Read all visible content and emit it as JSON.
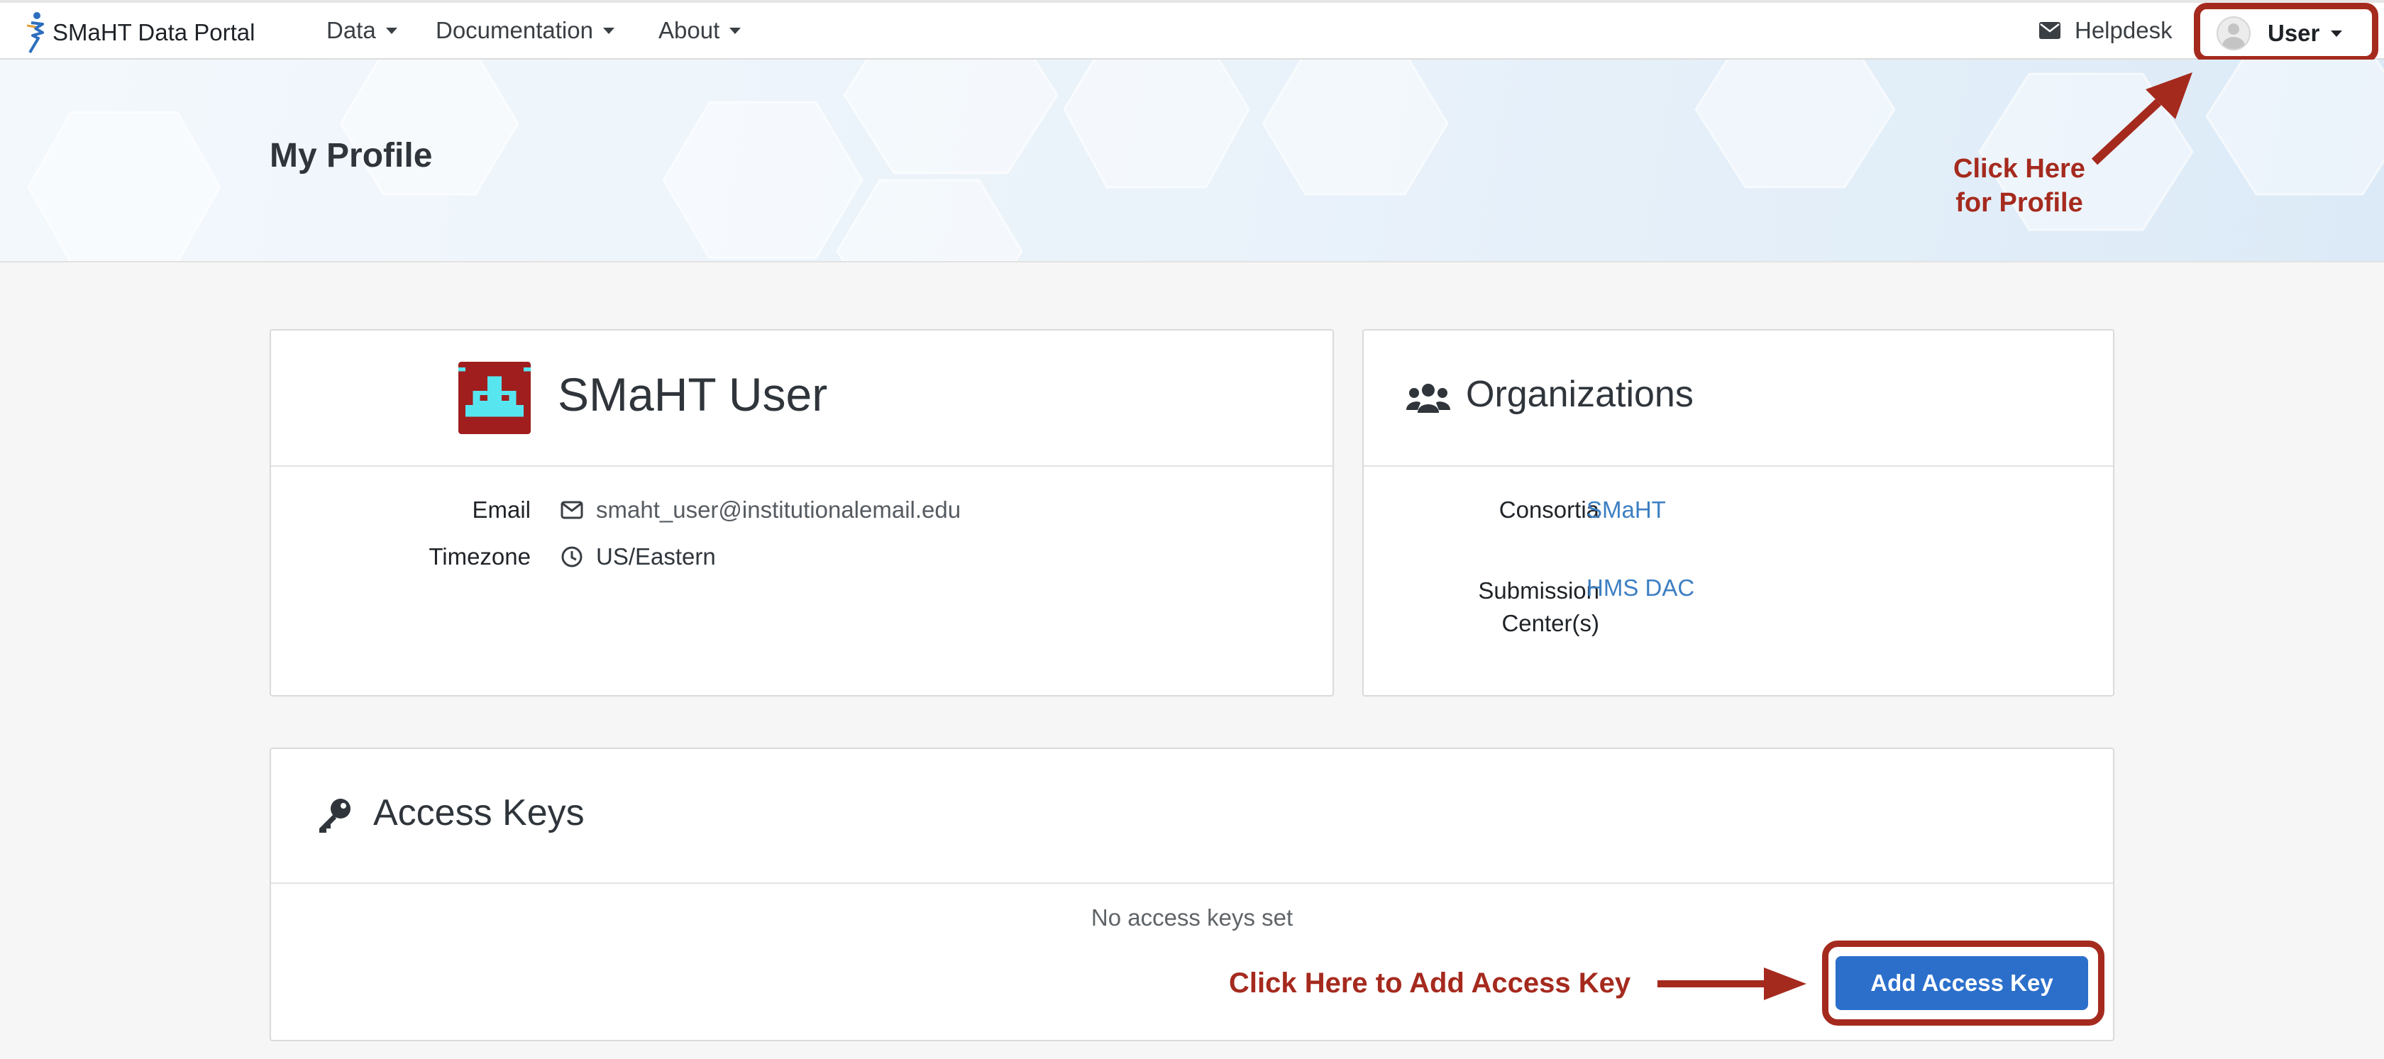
{
  "navbar": {
    "brand": "SMaHT Data Portal",
    "menus": [
      {
        "label": "Data"
      },
      {
        "label": "Documentation"
      },
      {
        "label": "About"
      }
    ],
    "helpdesk": "Helpdesk",
    "user_label": "User"
  },
  "hero": {
    "title": "My Profile",
    "annotation_profile_line1": "Click Here",
    "annotation_profile_line2": "for Profile"
  },
  "profile": {
    "name": "SMaHT User",
    "email_label": "Email",
    "email": "smaht_user@institutionalemail.edu",
    "timezone_label": "Timezone",
    "timezone": "US/Eastern"
  },
  "organizations": {
    "title": "Organizations",
    "consortia_label": "Consortia",
    "consortia_value": "SMaHT",
    "submission_label_line1": "Submission",
    "submission_label_line2": "Center(s)",
    "submission_value": "HMS DAC"
  },
  "access_keys": {
    "title": "Access Keys",
    "empty_message": "No access keys set",
    "add_button": "Add Access Key",
    "annotation": "Click Here to Add Access Key"
  },
  "colors": {
    "annotation": "#a52a1e",
    "primary_button": "#2b6fcb",
    "link": "#3d7fc3",
    "avatar_red": "#a01e1e",
    "avatar_cyan": "#57e6f0"
  },
  "icons": [
    "brand-logo-icon",
    "caret-down-icon",
    "envelope-icon",
    "user-avatar-icon",
    "identicon-avatar",
    "envelope-outline-icon",
    "clock-icon",
    "users-group-icon",
    "key-icon",
    "arrow-icon"
  ]
}
